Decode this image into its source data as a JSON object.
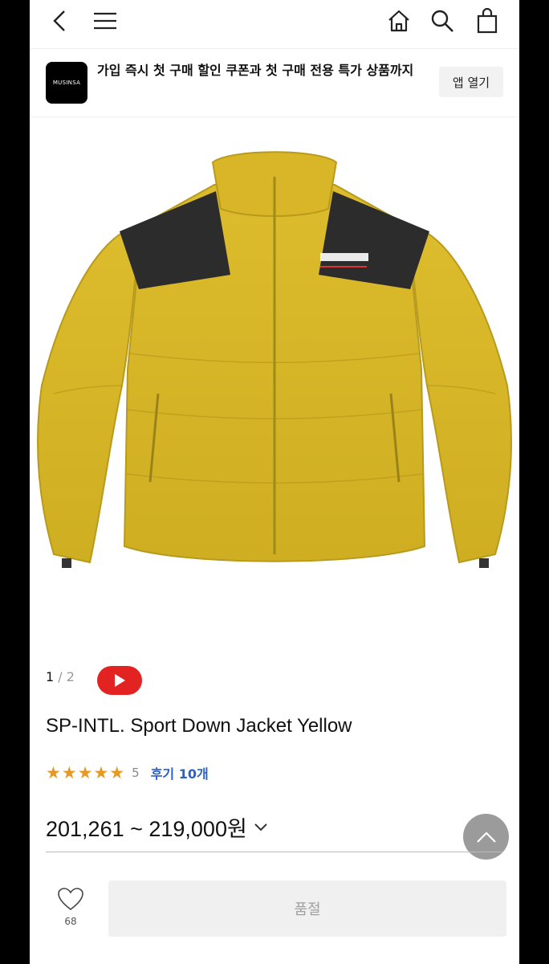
{
  "nav": {
    "back_icon": "chevron-left-icon",
    "menu_icon": "hamburger-icon",
    "home_icon": "home-icon",
    "search_icon": "search-icon",
    "cart_icon": "shopping-bag-icon"
  },
  "banner": {
    "logo_text": "MUSINSA",
    "message": "가입 즉시 첫 구매 할인 쿠폰과 첫 구매 전용 특가 상품까지",
    "button_label": "앱 열기"
  },
  "gallery": {
    "current": "1",
    "total": "2",
    "video_icon": "play-icon"
  },
  "product": {
    "title": "SP-INTL. Sport Down Jacket Yellow",
    "stars": "★★★★★",
    "rating": "5",
    "reviews": "후기 10개",
    "price": "201,261 ~ 219,000원"
  },
  "bottom": {
    "like_count": "68",
    "soldout_label": "품절"
  },
  "colors": {
    "jacket": "#d9b92a",
    "accent_red": "#e32222",
    "link_blue": "#2b61c7",
    "star": "#e69a22"
  }
}
